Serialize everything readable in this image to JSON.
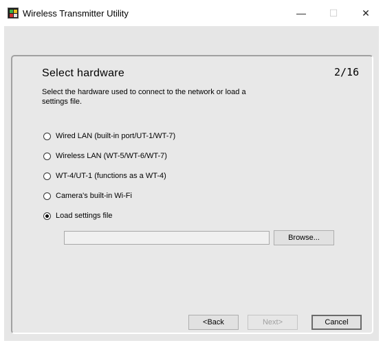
{
  "window": {
    "title": "Wireless Transmitter Utility",
    "controls": {
      "minimize": "—",
      "maximize": "☐",
      "close": "✕"
    }
  },
  "page": {
    "heading": "Select hardware",
    "page_indicator": "2/16",
    "description": "Select the hardware used to connect to the network or load a settings file."
  },
  "options": [
    {
      "label": "Wired LAN (built-in port/UT-1/WT-7)",
      "checked": false
    },
    {
      "label": "Wireless LAN (WT-5/WT-6/WT-7)",
      "checked": false
    },
    {
      "label": "WT-4/UT-1 (functions as a WT-4)",
      "checked": false
    },
    {
      "label": "Camera's built-in Wi-Fi",
      "checked": false
    },
    {
      "label": "Load settings file",
      "checked": true
    }
  ],
  "settings_file": {
    "value": "",
    "browse_label": "Browse..."
  },
  "footer": {
    "back_label": "<Back",
    "next_label": "Next>",
    "cancel_label": "Cancel"
  }
}
